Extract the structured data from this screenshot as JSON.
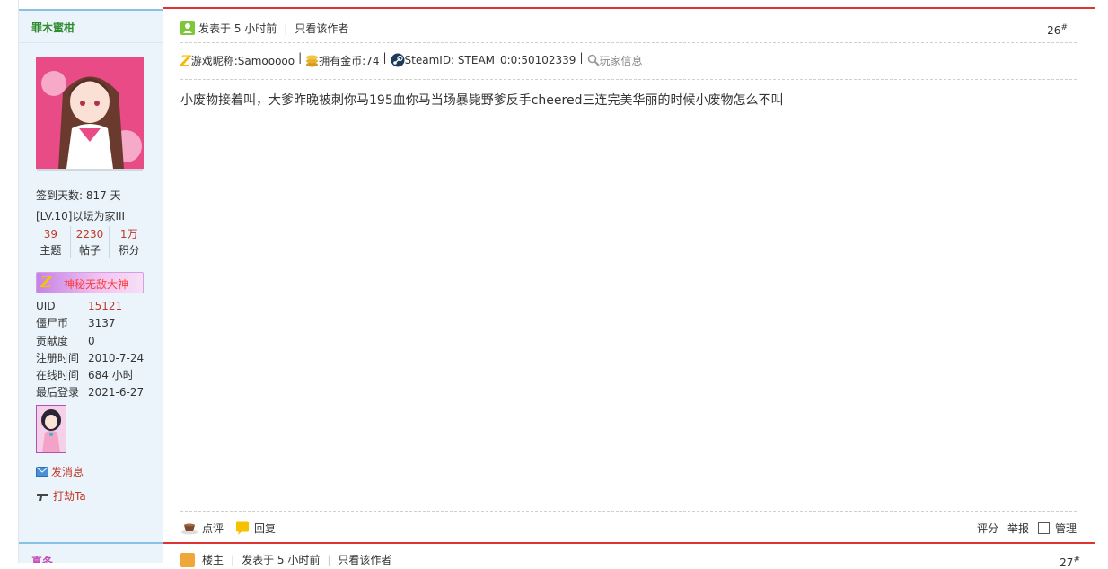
{
  "user": {
    "name": "罪木蜜柑",
    "checkin": "签到天数: 817 天",
    "level": "[LV.10]以坛为家III",
    "stats": [
      {
        "num": "39",
        "label": "主题"
      },
      {
        "num": "2230",
        "label": "帖子"
      },
      {
        "num": "1万",
        "label": "积分"
      }
    ],
    "medal_text": "神秘无敌大神",
    "info": [
      {
        "k": "UID",
        "v": "15121"
      },
      {
        "k": "僵尸币",
        "v": "3137"
      },
      {
        "k": "贡献度",
        "v": "0"
      },
      {
        "k": "注册时间",
        "v": "2010-7-24"
      },
      {
        "k": "在线时间",
        "v": "684 小时"
      },
      {
        "k": "最后登录",
        "v": "2021-6-27"
      }
    ],
    "send_message": "发消息",
    "rob": "打劫Ta"
  },
  "post": {
    "posted": "发表于 5 小时前",
    "only_author": "只看该作者",
    "floor": "26",
    "floor_mark": "#",
    "game_nick": "游戏昵称:Samooooo",
    "gold": "拥有金币:74",
    "steam": "SteamID: STEAM_0:0:50102339",
    "player_info": "玩家信息",
    "sep": "|",
    "content": "小废物接着叫，大爹昨晚被刺你马195血你马当场暴毙野爹反手cheered三连完美华丽的时候小废物怎么不叫",
    "comment": "点评",
    "reply": "回复",
    "rate": "评分",
    "report": "举报",
    "manage": "管理"
  },
  "next_post": {
    "name": "真冬",
    "head": "楼主",
    "posted": "发表于 5 小时前",
    "only_author": "只看该作者",
    "floor": "27",
    "floor_mark": "#"
  },
  "colors": {
    "accent_red": "#dd3333",
    "link_red": "#c0392b",
    "username_green": "#2c8b2c",
    "sidebar_bg": "#ebf4fa"
  }
}
